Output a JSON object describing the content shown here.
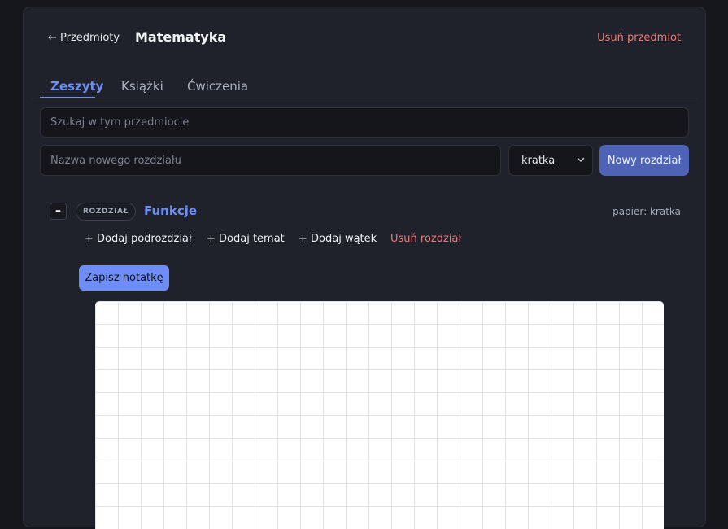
{
  "header": {
    "back_label": "← Przedmioty",
    "subject_title": "Matematyka",
    "delete_subject_label": "Usuń przedmiot"
  },
  "tabs": [
    {
      "label": "Zeszyty",
      "active": true
    },
    {
      "label": "Książki",
      "active": false
    },
    {
      "label": "Ćwiczenia",
      "active": false
    }
  ],
  "search": {
    "placeholder": "Szukaj w tym przedmiocie",
    "value": ""
  },
  "new_chapter": {
    "placeholder": "Nazwa nowego rozdziału",
    "value": "",
    "paper_select_value": "kratka",
    "button_label": "Nowy rozdział"
  },
  "chapter": {
    "collapse_symbol": "–",
    "badge": "ROZDZIAŁ",
    "name": "Funkcje",
    "paper_label": "papier: kratka",
    "actions": [
      {
        "label": "+ Dodaj podrozdział"
      },
      {
        "label": "+ Dodaj temat"
      },
      {
        "label": "+ Dodaj wątek"
      },
      {
        "label": "Usuń rozdział"
      }
    ],
    "save_note_label": "Zapisz notatkę"
  },
  "colors": {
    "accent": "#6f8df6",
    "danger": "#f0787a",
    "primary_button": "#4f63b6",
    "background": "#15171c",
    "card": "#1f222a"
  },
  "icons": {
    "select_chevron": "chevron-down-icon"
  }
}
